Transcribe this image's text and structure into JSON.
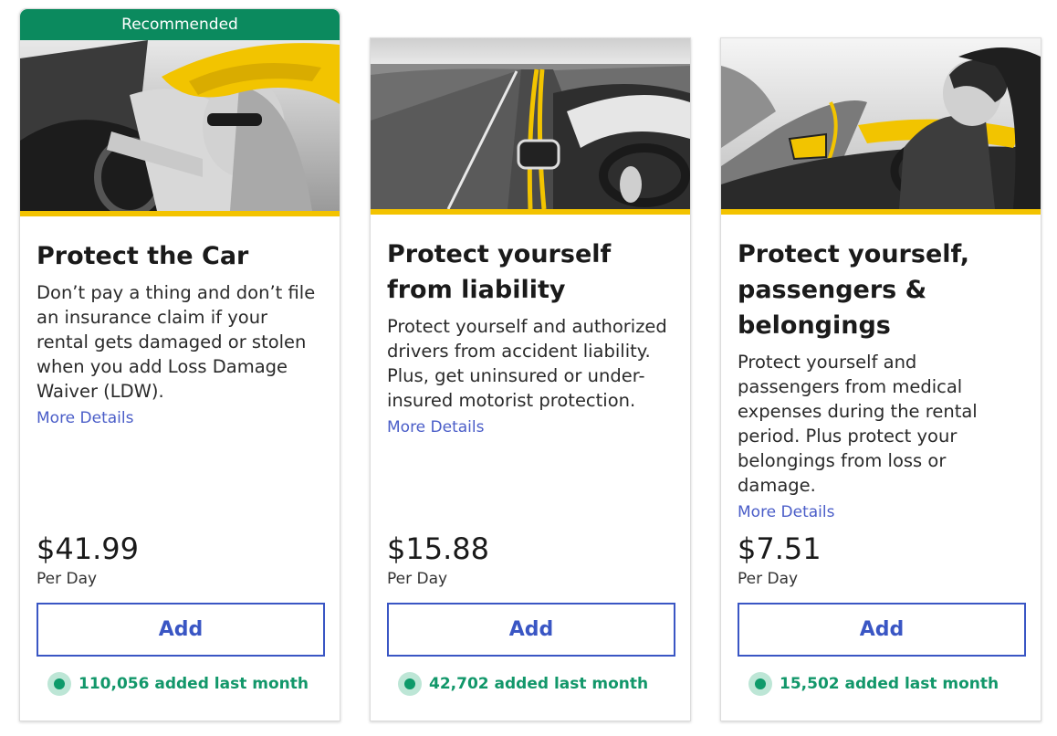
{
  "cards": [
    {
      "banner": "Recommended",
      "photo_icon": "driver-with-yellow-hat-photo",
      "title": "Protect the Car",
      "description": "Don’t pay a thing and don’t file an insurance claim if your rental gets damaged or stolen when you add Loss Damage Waiver (LDW).",
      "more_details": "More Details",
      "price": "$41.99",
      "price_unit": "Per Day",
      "add_label": "Add",
      "social_proof": "110,056 added last month"
    },
    {
      "photo_icon": "open-road-driving-photo",
      "title": "Protect yourself from liability",
      "description": "Protect yourself and authorized drivers from accident liability. Plus, get uninsured or under-insured motorist protection.",
      "more_details": "More Details",
      "price": "$15.88",
      "price_unit": "Per Day",
      "add_label": "Add",
      "social_proof": "42,702 added last month"
    },
    {
      "photo_icon": "convertible-driver-photo",
      "title": "Protect yourself, passengers & belongings",
      "description": "Protect yourself and passengers from medical expenses during the rental period. Plus protect your belongings from loss or damage.",
      "more_details": "More Details",
      "price": "$7.51",
      "price_unit": "Per Day",
      "add_label": "Add",
      "social_proof": "15,502 added last month"
    }
  ],
  "colors": {
    "banner_green": "#0b8a5e",
    "accent_yellow": "#f3c300",
    "button_blue": "#3a56c4",
    "link_blue": "#4a5dc8",
    "social_green": "#12976a"
  }
}
